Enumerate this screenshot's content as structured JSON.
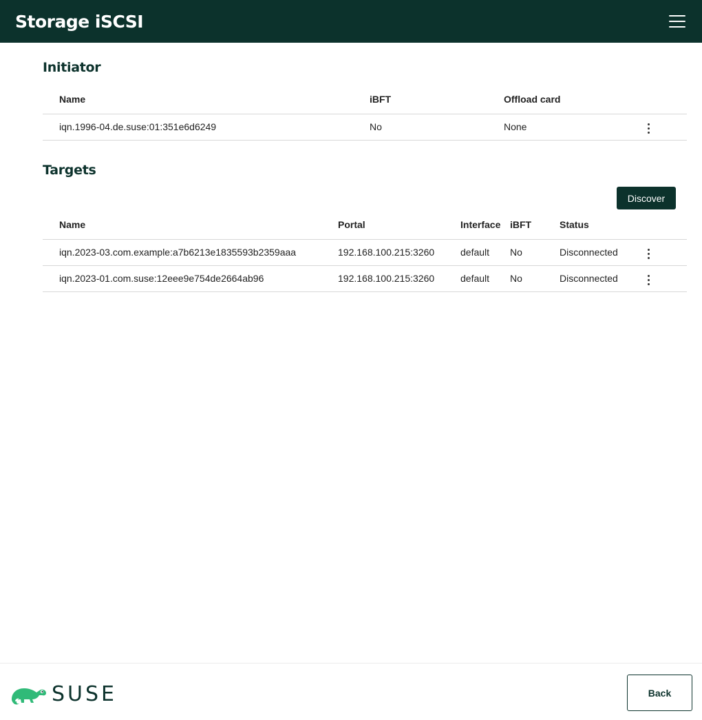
{
  "header": {
    "title": "Storage iSCSI",
    "menu_icon": "hamburger-menu-icon"
  },
  "initiator": {
    "title": "Initiator",
    "columns": [
      "Name",
      "iBFT",
      "Offload card"
    ],
    "rows": [
      {
        "name": "iqn.1996-04.de.suse:01:351e6d6249",
        "ibft": "No",
        "offload": "None"
      }
    ]
  },
  "targets": {
    "title": "Targets",
    "discover_label": "Discover",
    "columns": [
      "Name",
      "Portal",
      "Interface",
      "iBFT",
      "Status"
    ],
    "rows": [
      {
        "name": "iqn.2023-03.com.example:a7b6213e1835593b2359aaa",
        "portal": "192.168.100.215:3260",
        "interface": "default",
        "ibft": "No",
        "status": "Disconnected"
      },
      {
        "name": "iqn.2023-01.com.suse:12eee9e754de2664ab96",
        "portal": "192.168.100.215:3260",
        "interface": "default",
        "ibft": "No",
        "status": "Disconnected"
      }
    ]
  },
  "footer": {
    "logo_text": "SUSE",
    "back_label": "Back"
  },
  "colors": {
    "brand_dark": "#0c322c",
    "brand_green": "#30ba78"
  }
}
